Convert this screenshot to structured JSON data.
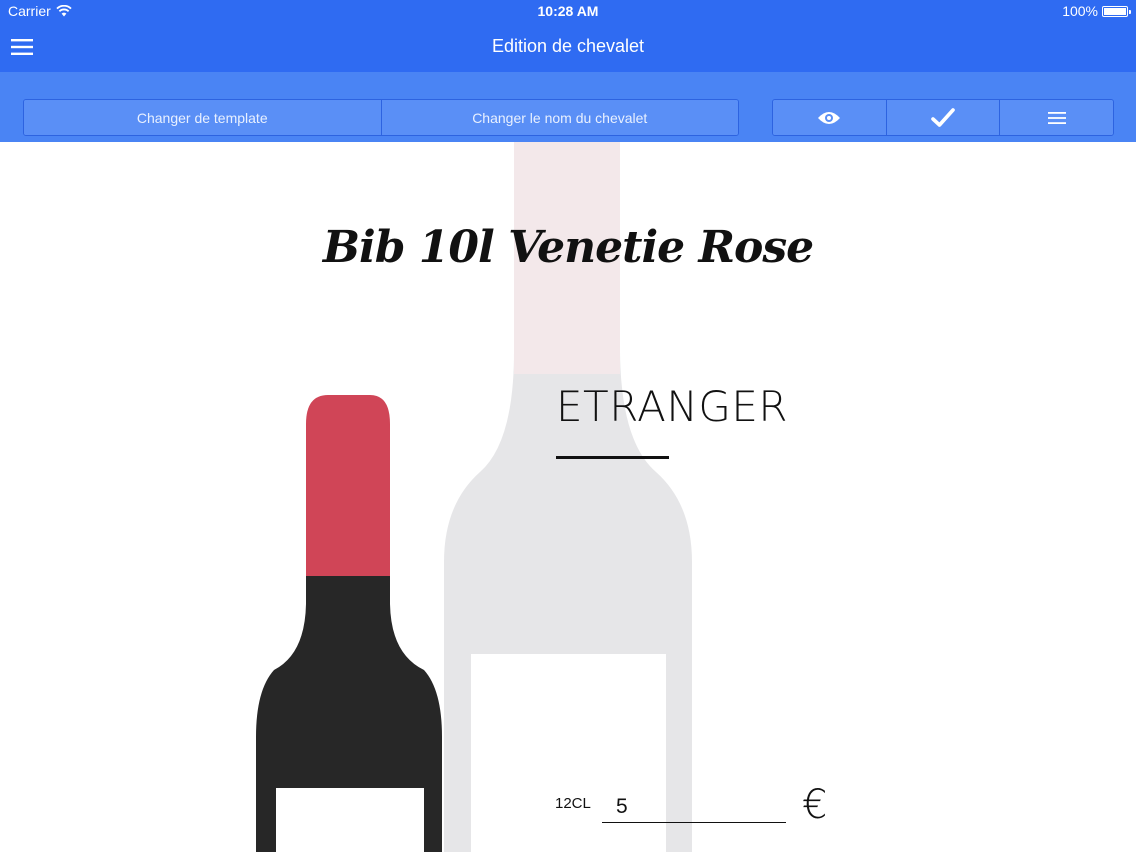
{
  "status_bar": {
    "carrier": "Carrier",
    "time": "10:28 AM",
    "battery": "100%"
  },
  "nav_bar": {
    "title": "Edition de chevalet",
    "menu_icon": "hamburger-menu-icon"
  },
  "toolbar": {
    "change_template_label": "Changer de template",
    "rename_label": "Changer le nom du chevalet",
    "preview_icon": "eye-icon",
    "validate_icon": "checkmark-icon",
    "options_icon": "list-menu-icon"
  },
  "card": {
    "name": "Bib 10l Venetie Rose",
    "origin": "ETRANGER",
    "volume_label": "12CL",
    "price_value": "5",
    "currency_symbol": "€"
  },
  "colors": {
    "primary": "#2f6bf2",
    "toolbar": "#4a84f4",
    "bottle_cap": "#d04557",
    "bottle_body": "#272727",
    "ghost_bottle": "#e6e6e8"
  }
}
